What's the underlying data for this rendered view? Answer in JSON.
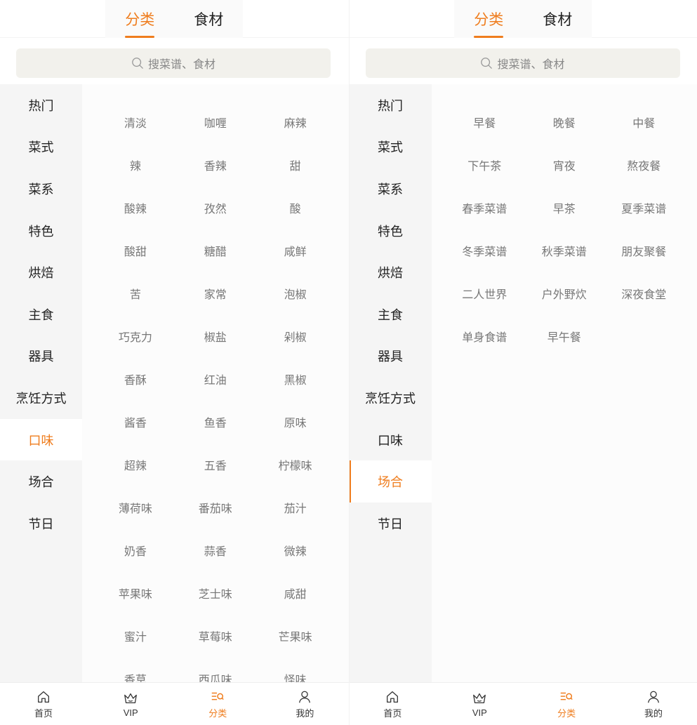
{
  "colors": {
    "accent": "#ef7d1e",
    "sidebar_bg": "#f5f5f5",
    "search_bg": "#f2f1ec",
    "text_muted": "#777777"
  },
  "screens": [
    {
      "top_tabs": [
        {
          "label": "分类",
          "active": true
        },
        {
          "label": "食材",
          "active": false
        }
      ],
      "search": {
        "placeholder": "搜菜谱、食材",
        "icon": "search-icon"
      },
      "sidebar": [
        {
          "label": "热门"
        },
        {
          "label": "菜式"
        },
        {
          "label": "菜系"
        },
        {
          "label": "特色"
        },
        {
          "label": "烘焙"
        },
        {
          "label": "主食"
        },
        {
          "label": "器具"
        },
        {
          "label": "烹饪方式"
        },
        {
          "label": "口味",
          "active": true
        },
        {
          "label": "场合"
        },
        {
          "label": "节日"
        }
      ],
      "items": [
        "清淡",
        "咖喱",
        "麻辣",
        "辣",
        "香辣",
        "甜",
        "酸辣",
        "孜然",
        "酸",
        "酸甜",
        "糖醋",
        "咸鲜",
        "苦",
        "家常",
        "泡椒",
        "巧克力",
        "椒盐",
        "剁椒",
        "香酥",
        "红油",
        "黑椒",
        "酱香",
        "鱼香",
        "原味",
        "超辣",
        "五香",
        "柠檬味",
        "薄荷味",
        "番茄味",
        "茄汁",
        "奶香",
        "蒜香",
        "微辣",
        "苹果味",
        "芝士味",
        "咸甜",
        "蜜汁",
        "草莓味",
        "芒果味",
        "香草",
        "西瓜味",
        "怪味"
      ],
      "bottom_nav": [
        {
          "label": "首页",
          "icon": "home-icon"
        },
        {
          "label": "VIP",
          "icon": "crown-icon"
        },
        {
          "label": "分类",
          "icon": "category-icon",
          "active": true
        },
        {
          "label": "我的",
          "icon": "user-icon"
        }
      ]
    },
    {
      "top_tabs": [
        {
          "label": "分类",
          "active": true
        },
        {
          "label": "食材",
          "active": false
        }
      ],
      "search": {
        "placeholder": "搜菜谱、食材",
        "icon": "search-icon"
      },
      "sidebar": [
        {
          "label": "热门"
        },
        {
          "label": "菜式"
        },
        {
          "label": "菜系"
        },
        {
          "label": "特色"
        },
        {
          "label": "烘焙"
        },
        {
          "label": "主食"
        },
        {
          "label": "器具"
        },
        {
          "label": "烹饪方式"
        },
        {
          "label": "口味"
        },
        {
          "label": "场合",
          "active": true
        },
        {
          "label": "节日"
        }
      ],
      "items": [
        "早餐",
        "晚餐",
        "中餐",
        "下午茶",
        "宵夜",
        "熬夜餐",
        "春季菜谱",
        "早茶",
        "夏季菜谱",
        "冬季菜谱",
        "秋季菜谱",
        "朋友聚餐",
        "二人世界",
        "户外野炊",
        "深夜食堂",
        "单身食谱",
        "早午餐"
      ],
      "bottom_nav": [
        {
          "label": "首页",
          "icon": "home-icon"
        },
        {
          "label": "VIP",
          "icon": "crown-icon"
        },
        {
          "label": "分类",
          "icon": "category-icon",
          "active": true
        },
        {
          "label": "我的",
          "icon": "user-icon"
        }
      ]
    }
  ]
}
